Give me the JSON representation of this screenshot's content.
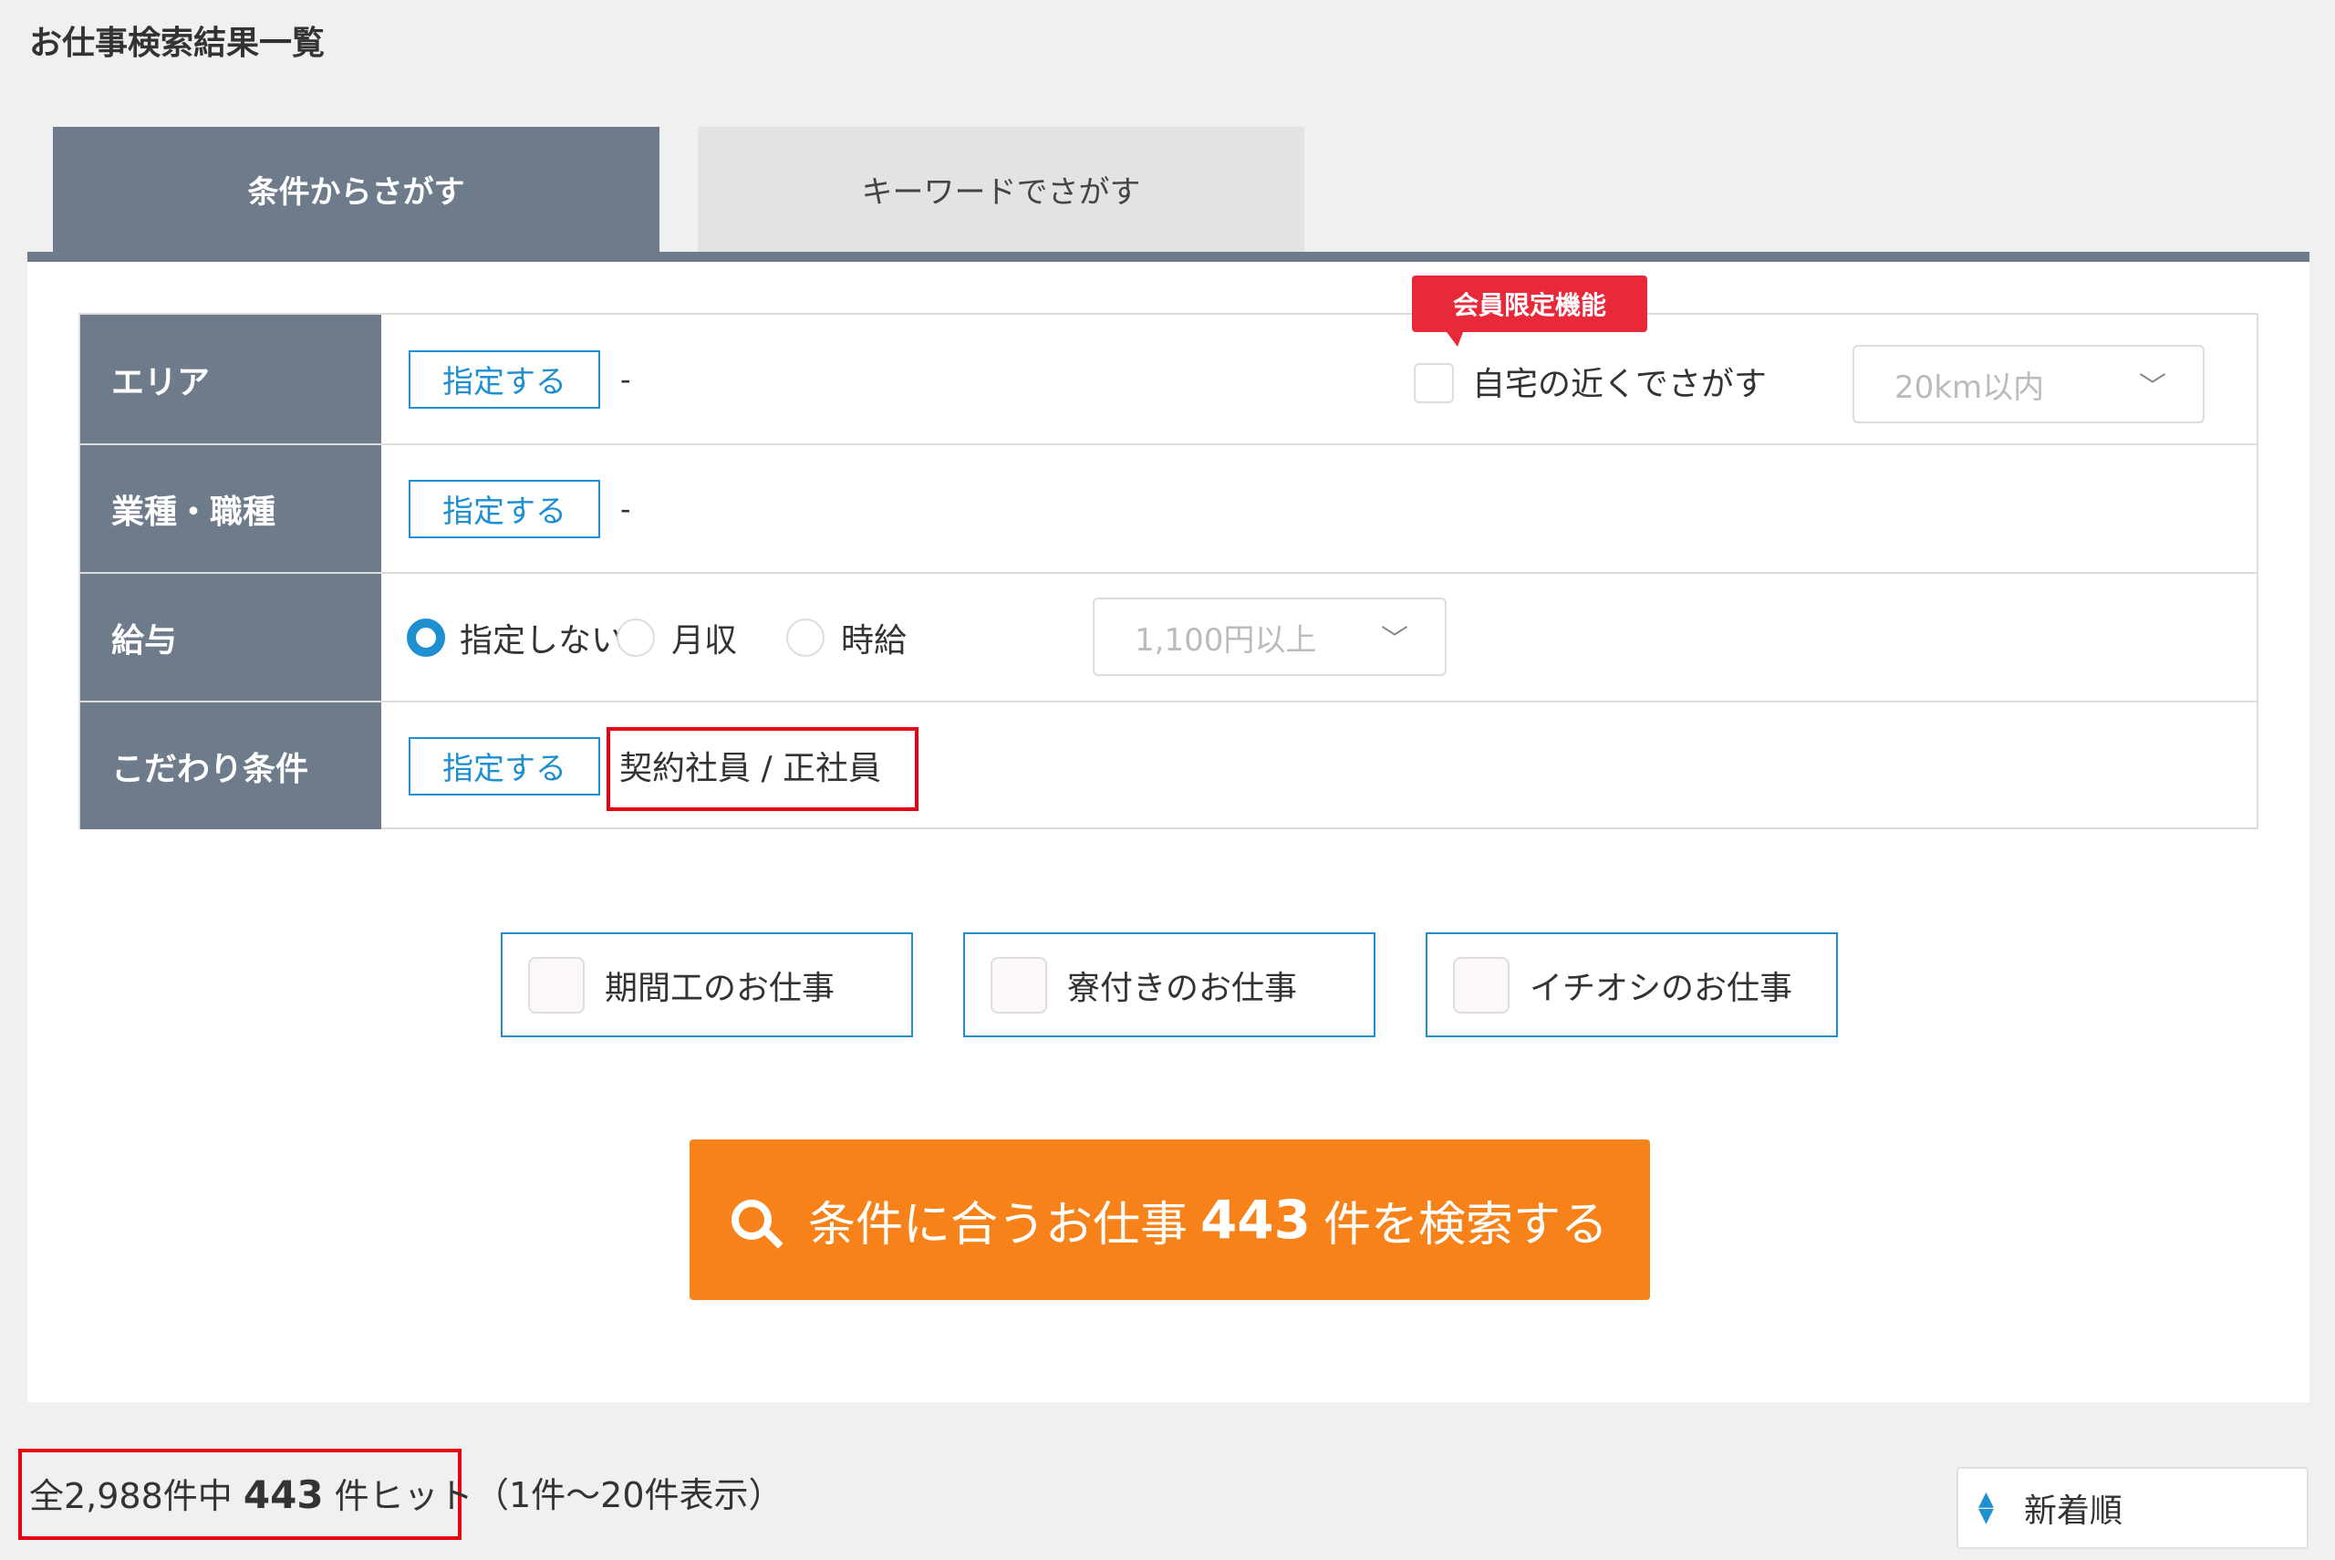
{
  "page": {
    "title": "お仕事検索結果一覧"
  },
  "tabs": [
    {
      "label": "条件からさがす",
      "active": true
    },
    {
      "label": "キーワードでさがす",
      "active": false
    }
  ],
  "conditions": {
    "area": {
      "label": "エリア",
      "button": "指定する",
      "value": "-"
    },
    "industry": {
      "label": "業種・職種",
      "button": "指定する",
      "value": "-"
    },
    "salary": {
      "label": "給与",
      "options": [
        "指定しない",
        "月収",
        "時給"
      ],
      "selected": "指定しない",
      "select_value": "1,100円以上"
    },
    "kodawari": {
      "label": "こだわり条件",
      "button": "指定する",
      "value": "契約社員 / 正社員"
    }
  },
  "member_only": {
    "badge": "会員限定機能",
    "near_home_label": "自宅の近くでさがす",
    "distance_value": "20km以内"
  },
  "quick_filters": [
    "期間工のお仕事",
    "寮付きのお仕事",
    "イチオシのお仕事"
  ],
  "search_button": {
    "prefix": "条件に合うお仕事",
    "count": "443",
    "suffix": "件を検索する"
  },
  "results": {
    "total_prefix": "全2,988件中",
    "hit_count": "443",
    "hit_suffix": "件ヒット",
    "range": "（1件〜20件表示）"
  },
  "sort": {
    "value": "新着順"
  },
  "colors": {
    "label_bg": "#6e7b8b",
    "accent_blue": "#1e8fd0",
    "search_orange": "#f78219",
    "badge_red": "#e8293a",
    "highlight_red": "#e60012"
  }
}
